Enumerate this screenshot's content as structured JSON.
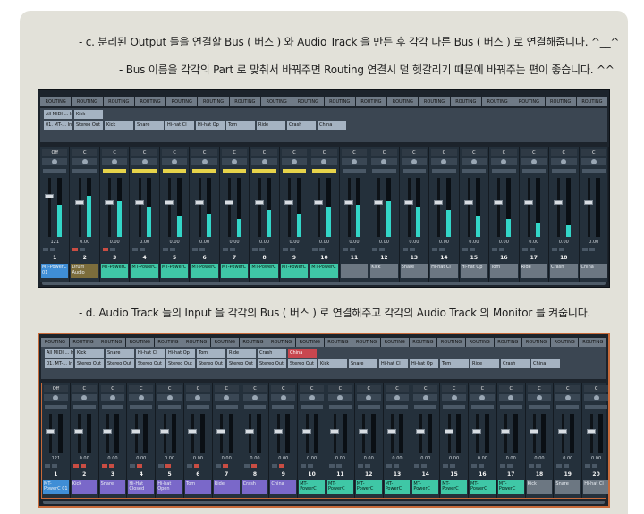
{
  "captions": {
    "c_line1": "- c. 분리된 Output 들을 연결할 Bus ( 버스 ) 와 Audio Track 을 만든 후 각각 다른 Bus ( 버스 ) 로 연결해줍니다. ^__^",
    "c_line2": "- Bus 이름을 각각의 Part 로 맞춰서 바꿔주면 Routing 연결시 덜 헷갈리기 때문에 바꿔주는 편이 좋습니다. ^^",
    "d_line1": "- d. Audio Track 들의 Input 을 각각의 Bus ( 버스 ) 로 연결해주고 각각의 Audio Track 의 Monitor 를 켜줍니다."
  },
  "mixer1": {
    "routing_label": "ROUTING",
    "routing_count": 18,
    "input_row": [
      "All MIDI ... In",
      "Kick"
    ],
    "output_row": [
      "01. MT-... In",
      "Stereo Out",
      "Kick",
      "Snare",
      "Hi-hat Cl",
      "Hi-hat Op",
      "Tom",
      "Ride",
      "Crash",
      "China"
    ],
    "strips": [
      {
        "top": "Off",
        "val": "121",
        "num": "1",
        "name": "MT-PowerC 01",
        "color": "blue",
        "meter": 0.55,
        "fader": 0.72
      },
      {
        "top": "C",
        "val": "0.00",
        "num": "2",
        "name": "Drum Audio",
        "color": "olive",
        "meter": 0.7,
        "fader": 0.62
      },
      {
        "top": "C",
        "val": "0.00",
        "num": "3",
        "name": "MT-PowerC",
        "color": "green",
        "meter": 0.6,
        "fader": 0.62
      },
      {
        "top": "C",
        "val": "0.00",
        "num": "4",
        "name": "MT-PowerC",
        "color": "green",
        "meter": 0.5,
        "fader": 0.62
      },
      {
        "top": "C",
        "val": "0.00",
        "num": "5",
        "name": "MT-PowerC",
        "color": "green",
        "meter": 0.35,
        "fader": 0.62
      },
      {
        "top": "C",
        "val": "0.00",
        "num": "6",
        "name": "MT-PowerC",
        "color": "green",
        "meter": 0.4,
        "fader": 0.62
      },
      {
        "top": "C",
        "val": "0.00",
        "num": "7",
        "name": "MT-PowerC",
        "color": "green",
        "meter": 0.3,
        "fader": 0.62
      },
      {
        "top": "C",
        "val": "0.00",
        "num": "8",
        "name": "MT-PowerC",
        "color": "green",
        "meter": 0.45,
        "fader": 0.62
      },
      {
        "top": "C",
        "val": "0.00",
        "num": "9",
        "name": "MT-PowerC",
        "color": "green",
        "meter": 0.4,
        "fader": 0.62
      },
      {
        "top": "C",
        "val": "0.00",
        "num": "10",
        "name": "MT-PowerC",
        "color": "green",
        "meter": 0.5,
        "fader": 0.62
      },
      {
        "top": "C",
        "val": "0.00",
        "num": "11",
        "name": "",
        "color": "gray",
        "meter": 0.55,
        "fader": 0.62
      },
      {
        "top": "C",
        "val": "0.00",
        "num": "12",
        "name": "Kick",
        "color": "gray",
        "meter": 0.6,
        "fader": 0.62
      },
      {
        "top": "C",
        "val": "0.00",
        "num": "13",
        "name": "Snare",
        "color": "gray",
        "meter": 0.5,
        "fader": 0.62
      },
      {
        "top": "C",
        "val": "0.00",
        "num": "14",
        "name": "Hi-hat Cl",
        "color": "gray",
        "meter": 0.45,
        "fader": 0.62
      },
      {
        "top": "C",
        "val": "0.00",
        "num": "15",
        "name": "Hi-hat Op",
        "color": "gray",
        "meter": 0.35,
        "fader": 0.62
      },
      {
        "top": "C",
        "val": "0.00",
        "num": "16",
        "name": "Tom",
        "color": "gray",
        "meter": 0.3,
        "fader": 0.62
      },
      {
        "top": "C",
        "val": "0.00",
        "num": "17",
        "name": "Ride",
        "color": "gray",
        "meter": 0.25,
        "fader": 0.62
      },
      {
        "top": "C",
        "val": "0.00",
        "num": "18",
        "name": "Crash",
        "color": "gray",
        "meter": 0.2,
        "fader": 0.62
      },
      {
        "top": "C",
        "val": "0.00",
        "num": "",
        "name": "China",
        "color": "gray",
        "meter": 0.0,
        "fader": 0.62
      }
    ]
  },
  "mixer2": {
    "routing_label": "ROUTING",
    "routing_count": 20,
    "input_row": [
      "All MIDI ... In",
      "Kick",
      "Snare",
      "Hi-hat Cl",
      "Hi-hat Op",
      "Tom",
      "Ride",
      "Crash",
      "China"
    ],
    "output_row": [
      "01. MT-... In",
      "Stereo Out",
      "Stereo Out",
      "Stereo Out",
      "Stereo Out",
      "Stereo Out",
      "Stereo Out",
      "Stereo Out",
      "Stereo Out",
      "Kick",
      "Snare",
      "Hi-hat Cl",
      "Hi-hat Op",
      "Tom",
      "Ride",
      "Crash",
      "China"
    ],
    "strips": [
      {
        "top": "Off",
        "val": "121",
        "num": "1",
        "name": "MT-PowerC 01",
        "color": "blue"
      },
      {
        "top": "C",
        "val": "0.00",
        "num": "2",
        "name": "Kick",
        "color": "purple"
      },
      {
        "top": "C",
        "val": "0.00",
        "num": "3",
        "name": "Snare",
        "color": "purple"
      },
      {
        "top": "C",
        "val": "0.00",
        "num": "4",
        "name": "Hi-Hat Closed",
        "color": "purple"
      },
      {
        "top": "C",
        "val": "0.00",
        "num": "5",
        "name": "Hi-hat Open",
        "color": "purple"
      },
      {
        "top": "C",
        "val": "0.00",
        "num": "6",
        "name": "Tom",
        "color": "purple"
      },
      {
        "top": "C",
        "val": "0.00",
        "num": "7",
        "name": "Ride",
        "color": "purple"
      },
      {
        "top": "C",
        "val": "0.00",
        "num": "8",
        "name": "Crash",
        "color": "purple"
      },
      {
        "top": "C",
        "val": "0.00",
        "num": "9",
        "name": "China",
        "color": "purple"
      },
      {
        "top": "C",
        "val": "0.00",
        "num": "10",
        "name": "MT-PowerC",
        "color": "green"
      },
      {
        "top": "C",
        "val": "0.00",
        "num": "11",
        "name": "MT-PowerC",
        "color": "green"
      },
      {
        "top": "C",
        "val": "0.00",
        "num": "12",
        "name": "MT-PowerC",
        "color": "green"
      },
      {
        "top": "C",
        "val": "0.00",
        "num": "13",
        "name": "MT-PowerC",
        "color": "green"
      },
      {
        "top": "C",
        "val": "0.00",
        "num": "14",
        "name": "MT-PowerC",
        "color": "green"
      },
      {
        "top": "C",
        "val": "0.00",
        "num": "15",
        "name": "MT-PowerC",
        "color": "green"
      },
      {
        "top": "C",
        "val": "0.00",
        "num": "16",
        "name": "MT-PowerC",
        "color": "green"
      },
      {
        "top": "C",
        "val": "0.00",
        "num": "17",
        "name": "MT-PowerC",
        "color": "green"
      },
      {
        "top": "C",
        "val": "0.00",
        "num": "18",
        "name": "Kick",
        "color": "gray"
      },
      {
        "top": "C",
        "val": "0.00",
        "num": "19",
        "name": "Snare",
        "color": "gray"
      },
      {
        "top": "C",
        "val": "0.00",
        "num": "20",
        "name": "Hi-hat Cl",
        "color": "gray"
      }
    ]
  },
  "colors": {
    "accent_orange": "#c76a3a",
    "meter_cyan": "#33d6c8",
    "solo_yellow": "#e6d34a"
  }
}
